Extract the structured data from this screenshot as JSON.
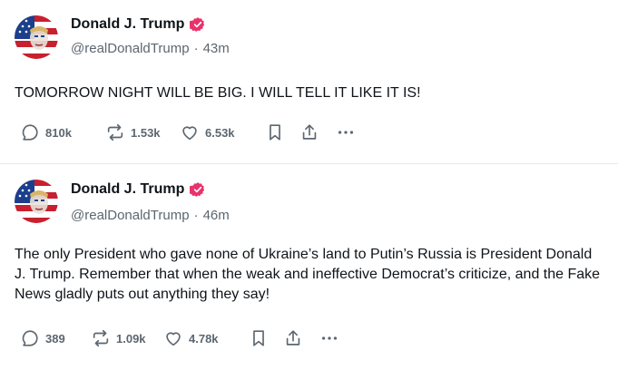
{
  "posts": [
    {
      "author_name": "Donald J. Trump",
      "handle": "@realDonaldTrump",
      "separator": "·",
      "time": "43m",
      "text": "TOMORROW NIGHT WILL BE BIG. I WILL TELL IT LIKE IT IS!",
      "reply_count": "810k",
      "repost_count": "1.53k",
      "like_count": "6.53k"
    },
    {
      "author_name": "Donald J. Trump",
      "handle": "@realDonaldTrump",
      "separator": "·",
      "time": "46m",
      "text": "The only President who gave none of Ukraine’s land to Putin’s Russia is President Donald J. Trump. Remember that when the weak and ineffective Democrat’s criticize, and the Fake News gladly puts out anything they say!",
      "reply_count": "389",
      "repost_count": "1.09k",
      "like_count": "4.78k"
    }
  ],
  "icons": {
    "verified": "verified-badge-icon",
    "reply": "reply-icon",
    "repost": "repost-icon",
    "like": "heart-icon",
    "bookmark": "bookmark-icon",
    "share": "share-icon",
    "more": "more-icon"
  },
  "colors": {
    "text": "#0f1419",
    "muted": "#5c6670",
    "verified_badge": "#e8336b",
    "divider": "#e6e8eb",
    "avatar_red": "#c8202e",
    "avatar_blue": "#1c3f8c"
  }
}
